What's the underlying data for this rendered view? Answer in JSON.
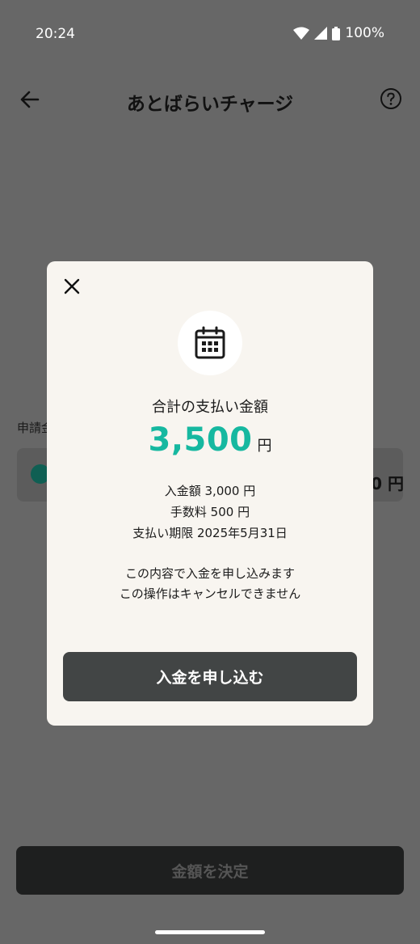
{
  "status_bar": {
    "time": "20:24",
    "battery_percent": "100%"
  },
  "app_bar": {
    "title": "あとばらいチャージ"
  },
  "background": {
    "section_label": "申請金",
    "amount_suffix": "0 円",
    "primary_button_label": "金額を決定"
  },
  "modal": {
    "title": "合計の支払い金額",
    "total_amount": "3,500",
    "currency_unit": "円",
    "deposit_line": "入金額 3,000 円",
    "fee_line": "手数料 500 円",
    "due_line": "支払い期限 2025年5月31日",
    "notice_line1": "この内容で入金を申し込みます",
    "notice_line2": "この操作はキャンセルできません",
    "apply_button_label": "入金を申し込む",
    "accent_color": "#16b8a0"
  },
  "icons": [
    "back-arrow-icon",
    "help-icon",
    "close-icon",
    "calendar-icon",
    "check-icon",
    "wifi-icon",
    "signal-icon",
    "battery-icon"
  ]
}
